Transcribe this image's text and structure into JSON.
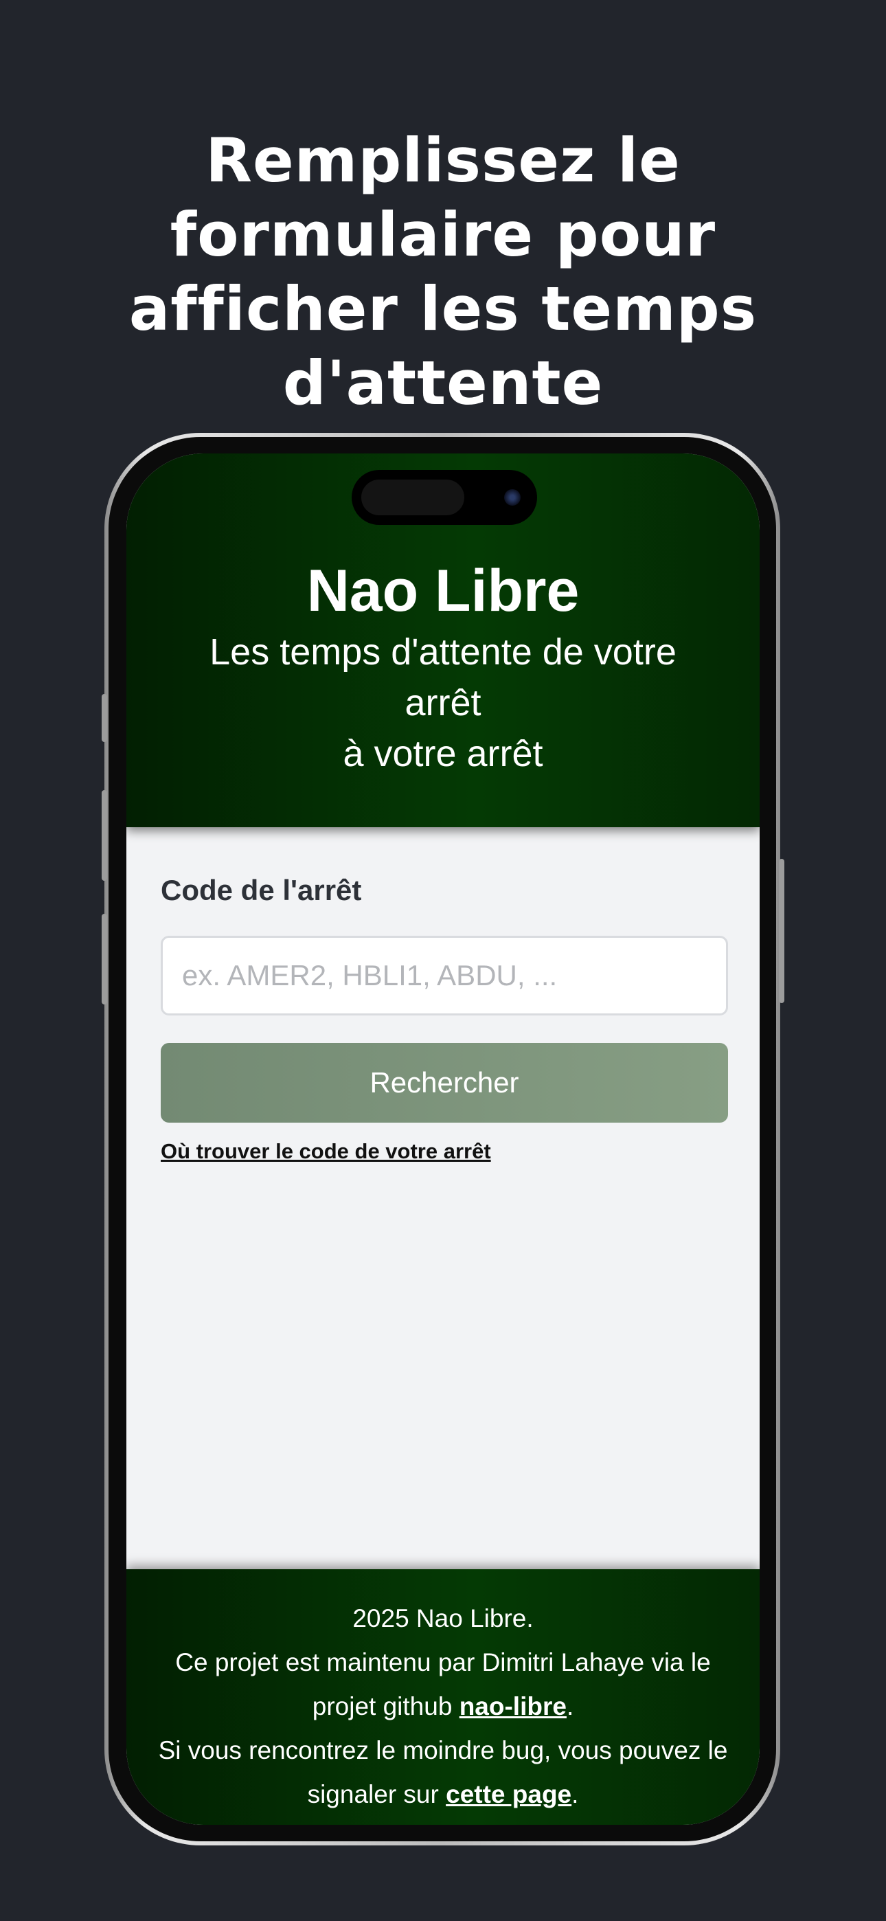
{
  "promo": {
    "title_lines": [
      "Remplissez le",
      "formulaire pour",
      "afficher les temps",
      "d'attente"
    ]
  },
  "header": {
    "title": "Nao Libre",
    "subtitle_line1": "Les temps d'attente de votre arrêt",
    "subtitle_line2": "à votre arrêt"
  },
  "form": {
    "label": "Code de l'arrêt",
    "input_value": "",
    "input_placeholder": "ex. AMER2, HBLI1, ABDU, ...",
    "search_label": "Rechercher",
    "help_link": "Où trouver le code de votre arrêt"
  },
  "footer": {
    "copyright": "2025 Nao Libre.",
    "maintained_text": "Ce projet est maintenu par Dimitri Lahaye via le projet github",
    "repo_link": "nao-libre",
    "bug_text": "Si vous rencontrez le moindre bug, vous pouvez le signaler sur",
    "bug_link": "cette page",
    "period": "."
  },
  "colors": {
    "background": "#22252c",
    "header_green": "#043a04",
    "button_green": "#7d947b",
    "content_bg": "#f2f3f5"
  }
}
